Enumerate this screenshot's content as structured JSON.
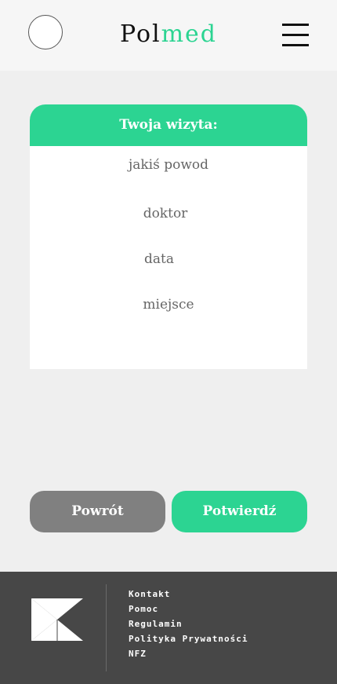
{
  "header": {
    "brand_prefix": "Pol",
    "brand_accent": "med",
    "accent_color": "#2cd492"
  },
  "visit": {
    "title": "Twoja wizyta:",
    "reason": "jakiś powod",
    "doctor": "doktor",
    "date": "data",
    "place": "miejsce"
  },
  "actions": {
    "back_label": "Powrót",
    "confirm_label": "Potwierdź"
  },
  "footer": {
    "links": [
      "Kontakt",
      "Pomoc",
      "Regulamin",
      "Polityka Prywatności",
      "NFZ"
    ]
  },
  "icons": {
    "menu": "hamburger-menu-icon",
    "avatar": "user-avatar-circle",
    "logo": "hourglass-logo-icon"
  }
}
